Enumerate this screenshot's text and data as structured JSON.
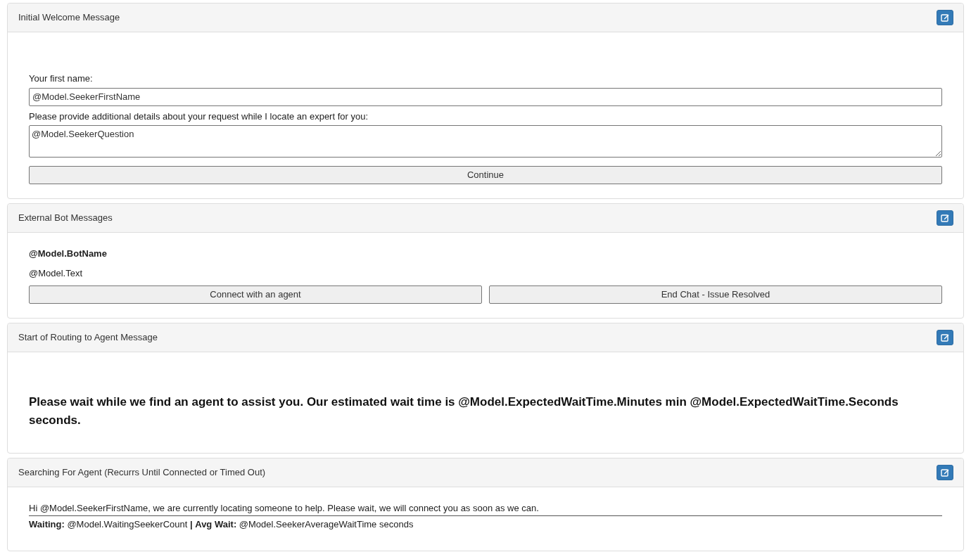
{
  "panels": [
    {
      "title": "Initial Welcome Message",
      "items": [
        {
          "kind": "spacer"
        },
        {
          "kind": "label",
          "text": "Your first name:"
        },
        {
          "kind": "input",
          "value": "@Model.SeekerFirstName"
        },
        {
          "kind": "label",
          "text": "Please provide additional details about your request while I locate an expert for you:"
        },
        {
          "kind": "textarea",
          "value": "@Model.SeekerQuestion"
        },
        {
          "kind": "buttons",
          "labels": [
            "Continue"
          ]
        }
      ]
    },
    {
      "title": "External Bot Messages",
      "items": [
        {
          "kind": "bold",
          "text": "@Model.BotName"
        },
        {
          "kind": "text",
          "text": "@Model.Text"
        },
        {
          "kind": "buttons",
          "labels": [
            "Connect with an agent",
            "End Chat - Issue Resolved"
          ]
        }
      ]
    },
    {
      "title": "Start of Routing to Agent Message",
      "items": [
        {
          "kind": "spacer"
        },
        {
          "kind": "heading",
          "text": "Please wait while we find an agent to assist you. Our estimated wait time is @Model.ExpectedWaitTime.Minutes min @Model.ExpectedWaitTime.Seconds seconds."
        }
      ]
    },
    {
      "title": "Searching For Agent (Recurrs Until Connected or Timed Out)",
      "items": [
        {
          "kind": "underlined",
          "text": "Hi @Model.SeekerFirstName, we are currently locating someone to help. Please wait, we will connect you as soon as we can."
        },
        {
          "kind": "text",
          "text": "**Waiting:** @Model.WaitingSeekerCount **|** **Avg Wait:** @Model.SeekerAverageWaitTime seconds"
        }
      ]
    }
  ]
}
